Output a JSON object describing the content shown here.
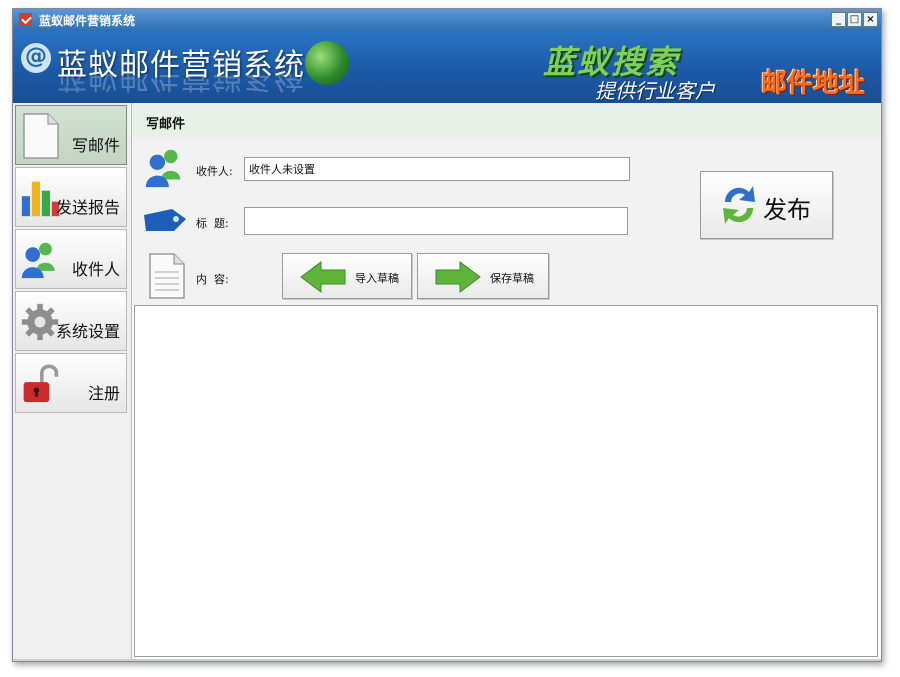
{
  "window": {
    "title": "蓝蚁邮件营销系统",
    "controls": {
      "minimize": "_",
      "maximize": "□",
      "close": "×"
    }
  },
  "banner": {
    "app_name": "蓝蚁邮件营销系统",
    "logo_text": "蓝蚁搜索",
    "slogan_1": "提供行业客户",
    "slogan_2": "邮件地址"
  },
  "sidebar": {
    "items": [
      {
        "label": "写邮件",
        "icon": "document-icon",
        "active": true
      },
      {
        "label": "发送报告",
        "icon": "bar-chart-icon",
        "active": false
      },
      {
        "label": "收件人",
        "icon": "users-icon",
        "active": false
      },
      {
        "label": "系统设置",
        "icon": "gear-icon",
        "active": false
      },
      {
        "label": "注册",
        "icon": "unlocked-padlock-icon",
        "active": false
      }
    ]
  },
  "compose": {
    "section_title": "写邮件",
    "recipient_label": "收件人:",
    "recipient_value": "收件人未设置",
    "subject_label": "标  题:",
    "subject_value": "",
    "content_label": "内  容:",
    "import_draft_label": "导入草稿",
    "save_draft_label": "保存草稿",
    "publish_label": "发布"
  },
  "colors": {
    "title_bar": "#2d6fb3",
    "banner": "#1b5aa7",
    "logo_green": "#7fd15a",
    "slogan_orange": "#ff6a1a",
    "section_bar": "#e8f1e8",
    "arrow_green": "#5fb53a"
  }
}
